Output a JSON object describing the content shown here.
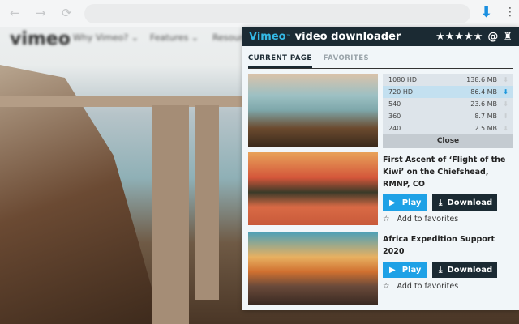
{
  "browser": {
    "back": "←",
    "forward": "→",
    "reload": "⟳",
    "ext_icon": "download-arrow",
    "menu": "⋮"
  },
  "site": {
    "logo": "vimeo",
    "nav": [
      "Why Vimeo? ⌄",
      "Features ⌄",
      "Resources"
    ]
  },
  "popup": {
    "brand": "Vimeo",
    "tm": "™",
    "title": "video downloader",
    "header_icons": {
      "stars": "★★★★★",
      "at": "@",
      "clean": "♜"
    },
    "tabs": [
      {
        "label": "CURRENT PAGE",
        "active": true
      },
      {
        "label": "FAVORITES",
        "active": false
      }
    ],
    "qualities": [
      {
        "q": "1080 HD",
        "size": "138.6 MB"
      },
      {
        "q": "720 HD",
        "size": "86.4 MB",
        "selected": true
      },
      {
        "q": "540",
        "size": "23.6 MB"
      },
      {
        "q": "360",
        "size": "8.7 MB"
      },
      {
        "q": "240",
        "size": "2.5 MB"
      }
    ],
    "close_label": "Close",
    "videos": [
      {
        "title": "First Ascent of ‘Flight of the Kiwi’ on the Chiefshead, RMNP, CO"
      },
      {
        "title": "Africa Expedition Support 2020"
      }
    ],
    "play_label": "Play",
    "download_label": "Download",
    "favorite_label": "Add to favorites"
  }
}
